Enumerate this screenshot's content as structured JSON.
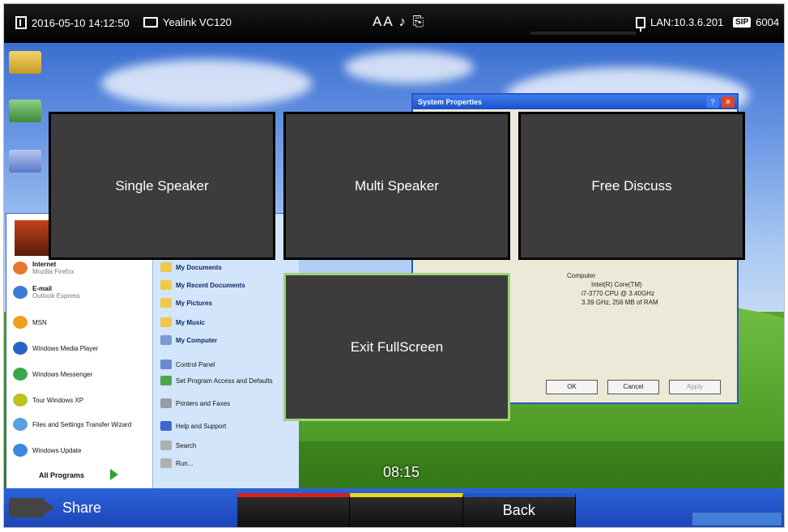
{
  "status_bar": {
    "datetime": "2016-05-10 14:12:50",
    "device": "Yealink VC120",
    "center_icons": "AA ♪ ⎘",
    "lan": "LAN:10.3.6.201",
    "sip_badge": "SIP",
    "sip_account": "6004"
  },
  "desktop": {
    "window_title": "System Properties",
    "computer_info": {
      "label": "Computer",
      "line1": "Intel(R) Core(TM)",
      "line2": "i7-3770 CPU @ 3.40GHz",
      "line3": "3.39 GHz, 256 MB of RAM"
    },
    "dialog_buttons": [
      "OK",
      "Cancel",
      "Apply"
    ],
    "start_menu_left": [
      {
        "label": "Internet",
        "sub": "Mozilla Firefox"
      },
      {
        "label": "E-mail",
        "sub": "Outlook Express"
      },
      {
        "label": "MSN"
      },
      {
        "label": "Windows Media Player"
      },
      {
        "label": "Windows Messenger"
      },
      {
        "label": "Tour Windows XP"
      },
      {
        "label": "Files and Settings Transfer Wizard"
      },
      {
        "label": "Windows Update"
      }
    ],
    "all_programs": "All Programs",
    "start_menu_right": [
      "My Documents",
      "My Recent Documents",
      "My Pictures",
      "My Music",
      "My Computer",
      "Control Panel",
      "Set Program Access and Defaults",
      "Printers and Faxes",
      "Help and Support",
      "Search",
      "Run..."
    ]
  },
  "menu_tiles": {
    "single_speaker": "Single Speaker",
    "multi_speaker": "Multi Speaker",
    "free_discuss": "Free Discuss",
    "exit_fullscreen": "Exit FullScreen"
  },
  "timer": "08:15",
  "bottom": {
    "share": "Share",
    "softkey_back": "Back"
  },
  "colors": {
    "softkey_red": "#d3231c",
    "softkey_yellow": "#e7d71f",
    "softkey_blue": "#1d58c8",
    "selected_border": "#9fd27a"
  }
}
